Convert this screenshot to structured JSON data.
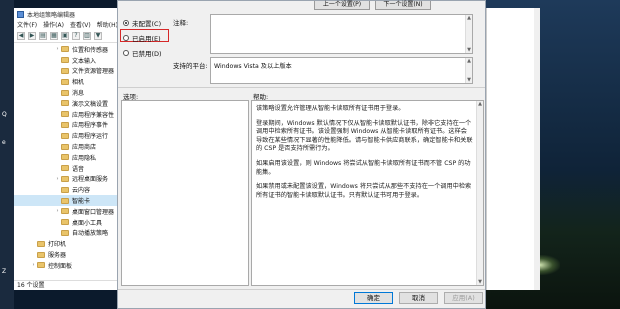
{
  "desktop": {
    "left_labels": [
      "Q",
      "e",
      "Z"
    ]
  },
  "editor": {
    "title": "本地组策略编辑器",
    "menu": [
      "文件(F)",
      "操作(A)",
      "查看(V)",
      "帮助(H)"
    ],
    "tree": [
      {
        "label": "位置和传感器",
        "expandable": true,
        "selected": false
      },
      {
        "label": "文本输入",
        "expandable": false,
        "selected": false
      },
      {
        "label": "文件资源管理器",
        "expandable": false,
        "selected": false
      },
      {
        "label": "相机",
        "expandable": false,
        "selected": false
      },
      {
        "label": "消息",
        "expandable": false,
        "selected": false
      },
      {
        "label": "演示文稿设置",
        "expandable": false,
        "selected": false
      },
      {
        "label": "应用程序兼容性",
        "expandable": false,
        "selected": false
      },
      {
        "label": "应用程序事件",
        "expandable": false,
        "selected": false
      },
      {
        "label": "应用程序运行",
        "expandable": false,
        "selected": false
      },
      {
        "label": "应用商店",
        "expandable": false,
        "selected": false
      },
      {
        "label": "应用隐私",
        "expandable": false,
        "selected": false
      },
      {
        "label": "语音",
        "expandable": false,
        "selected": false
      },
      {
        "label": "远程桌面服务",
        "expandable": true,
        "selected": false
      },
      {
        "label": "云内容",
        "expandable": false,
        "selected": false
      },
      {
        "label": "智能卡",
        "expandable": false,
        "selected": true
      },
      {
        "label": "桌面窗口管理器",
        "expandable": true,
        "selected": false
      },
      {
        "label": "桌面小工具",
        "expandable": false,
        "selected": false
      },
      {
        "label": "自动播放策略",
        "expandable": false,
        "selected": false
      },
      {
        "label": "打印机",
        "expandable": false,
        "selected": false
      },
      {
        "label": "服务器",
        "expandable": false,
        "selected": false
      },
      {
        "label": "控制面板",
        "expandable": true,
        "selected": false
      }
    ],
    "status": "16 个设置"
  },
  "dialog": {
    "top_prev_button": "上一个设置(P)",
    "top_next_button": "下一个设置(N)",
    "options": {
      "not_configured": "未配置(C)",
      "enabled": "已启用(E)",
      "disabled": "已禁用(D)",
      "selected": "not_configured"
    },
    "comment_label": "注释:",
    "supported_label": "支持的平台:",
    "supported_value": "Windows Vista 及以上版本",
    "options_label": "选项:",
    "help_label": "帮助:",
    "help_paragraphs": [
      "该策略设置允许管理从智能卡读取所有证书用于登录。",
      "登录期间，Windows 默认情况下仅从智能卡读取默认证书，除非它支持在一个调用中检索所有证书。该设置强制 Windows 从智能卡读取所有证书。这样会导致在某些情况下显著的性能降低。请与智能卡供应商联系，确定智能卡和关联的 CSP 是否支持所需行为。",
      "如果启用该设置，则 Windows 将尝试从智能卡读取所有证书而不管 CSP 的功能集。",
      "如果禁用或未配置该设置，Windows 将只尝试从那些不支持在一个调用中检索所有证书的智能卡读取默认证书。只有默认证书可用于登录。"
    ],
    "ok_button": "确定",
    "cancel_button": "取消",
    "apply_button": "应用(A)"
  }
}
